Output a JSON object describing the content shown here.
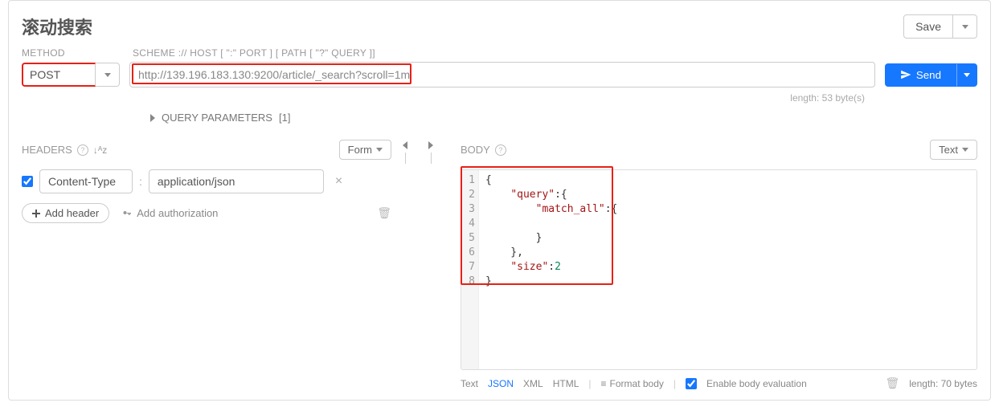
{
  "title": "滚动搜索",
  "save": {
    "label": "Save"
  },
  "labels": {
    "method": "METHOD",
    "url": "SCHEME :// HOST [ \":\" PORT ] [ PATH [ \"?\" QUERY ]]"
  },
  "method": {
    "value": "POST"
  },
  "url": {
    "value": "http://139.196.183.130:9200/article/_search?scroll=1m"
  },
  "send": {
    "label": "Send"
  },
  "meta": {
    "length_label": "length: 53 byte(s)"
  },
  "qp": {
    "label": "QUERY PARAMETERS",
    "count": "[1]"
  },
  "headers_section": {
    "title": "HEADERS",
    "form_btn": "Form",
    "rows": [
      {
        "enabled": true,
        "key": "Content-Type",
        "value": "application/json"
      }
    ],
    "add_header": "Add header",
    "add_auth": "Add authorization"
  },
  "body_section": {
    "title": "BODY",
    "mode_btn": "Text",
    "lines": [
      "{",
      "    \"query\":{",
      "        \"match_all\":{",
      "",
      "        }",
      "    },",
      "    \"size\":2",
      "}"
    ],
    "footer": {
      "tabs": [
        "Text",
        "JSON",
        "XML",
        "HTML"
      ],
      "active_tab": "JSON",
      "format": "Format body",
      "eval": "Enable body evaluation",
      "length": "length: 70 bytes"
    }
  }
}
